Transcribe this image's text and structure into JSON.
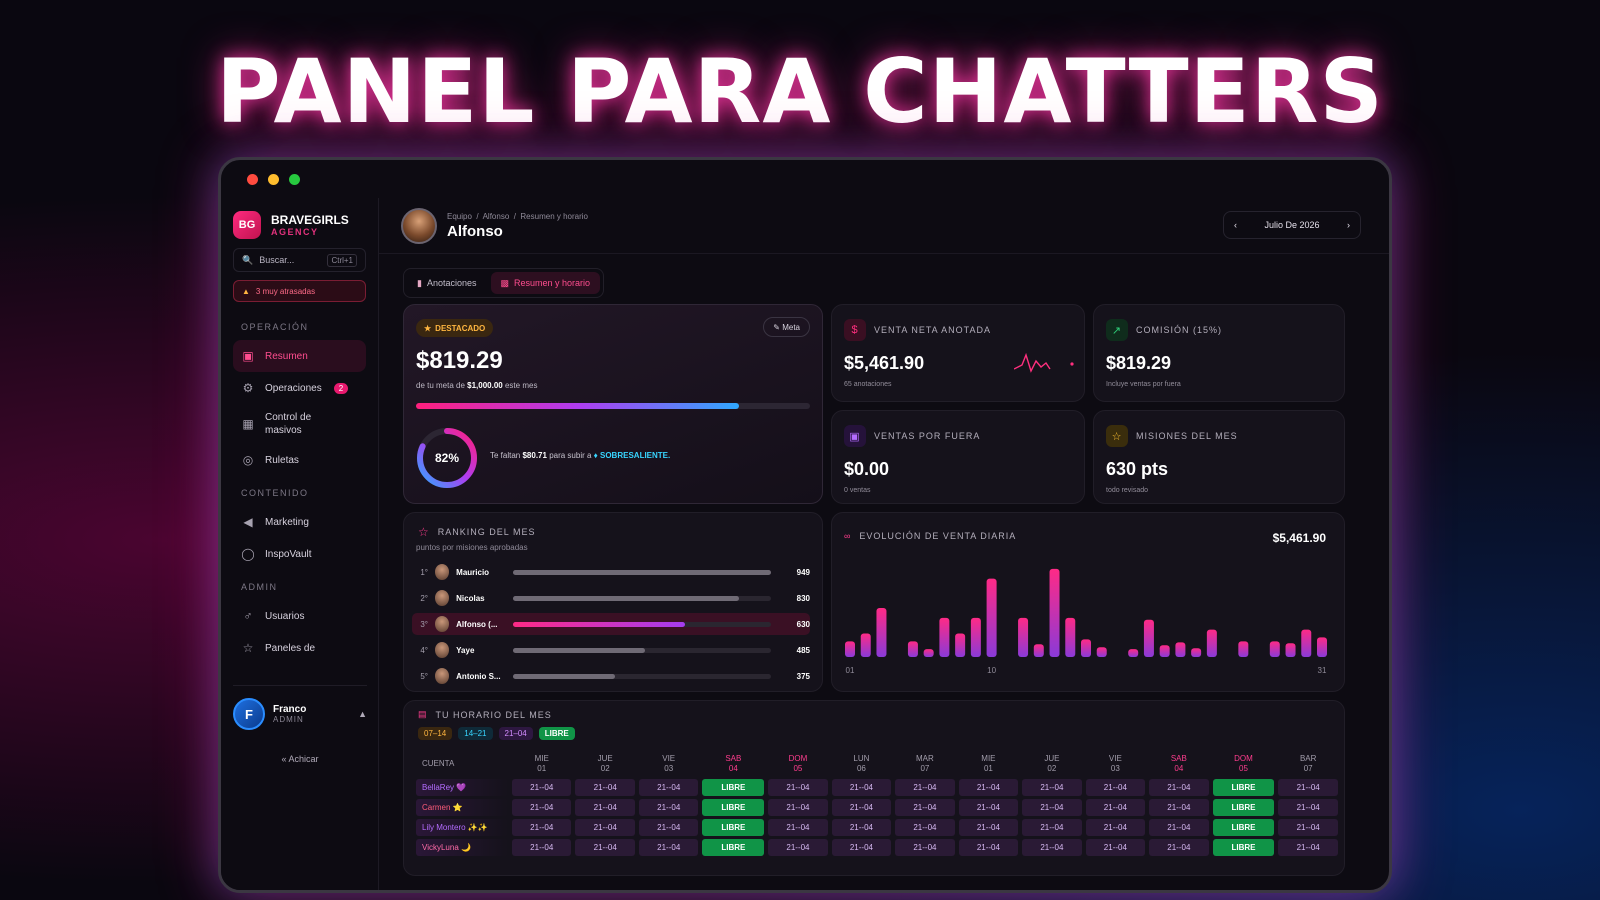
{
  "hero_title": "PANEL PARA CHATTERS",
  "sidebar": {
    "logo": "BG",
    "brand": "BRAVEGIRLS",
    "brand_sub": "AGENCY",
    "search_placeholder": "Buscar...",
    "search_shortcut": "Ctrl+1",
    "late_alert": "3 muy atrasadas",
    "sections": {
      "operacion": "OPERACIÓN",
      "contenido": "CONTENIDO",
      "admin": "ADMIN"
    },
    "items": [
      {
        "label": "Resumen",
        "icon": "gift-icon"
      },
      {
        "label": "Operaciones",
        "icon": "gear-icon",
        "badge": "2"
      },
      {
        "label": "Control de masivos",
        "icon": "film-icon"
      },
      {
        "label": "Ruletas",
        "icon": "globe-icon"
      },
      {
        "label": "Marketing",
        "icon": "megaphone-icon"
      },
      {
        "label": "InspoVault",
        "icon": "lightbulb-icon"
      },
      {
        "label": "Usuarios",
        "icon": "user-icon"
      },
      {
        "label": "Paneles de",
        "icon": "star-icon"
      }
    ],
    "user": {
      "initial": "F",
      "name": "Franco",
      "role": "ADMIN"
    },
    "collapse": "« Achicar"
  },
  "header": {
    "breadcrumb": [
      "Equipo",
      "Alfonso",
      "Resumen y horario"
    ],
    "name": "Alfonso",
    "month": "Julio De 2026"
  },
  "tabs": [
    "Anotaciones",
    "Resumen y horario"
  ],
  "featured": {
    "badge": "DESTACADO",
    "meta_button": "Meta",
    "value": "$819.29",
    "goal_prefix": "de tu meta de",
    "goal_amount": "$1,000.00",
    "goal_suffix": "este mes",
    "progress": 0.82,
    "percent": "82%",
    "remaining_prefix": "Te faltan",
    "remaining_amount": "$80.71",
    "remaining_mid": "para subir a",
    "next_level": "SOBRESALIENTE."
  },
  "kpis": [
    {
      "title": "VENTA NETA ANOTADA",
      "value": "$5,461.90",
      "sub": "65 anotaciones",
      "color": "#ff2f7e"
    },
    {
      "title": "COMISIÓN (15%)",
      "value": "$819.29",
      "sub": "Incluye ventas por fuera",
      "color": "#2fd07a"
    },
    {
      "title": "VENTAS POR FUERA",
      "value": "$0.00",
      "sub": "0 ventas",
      "color": "#b36cff"
    },
    {
      "title": "MISIONES DEL MES",
      "value": "630 pts",
      "sub": "todo revisado",
      "color": "#ffc233"
    }
  ],
  "ranking": {
    "title": "RANKING DEL MES",
    "subtitle": "puntos por misiones aprobadas",
    "max": 949,
    "rows": [
      {
        "pos": "1°",
        "name": "Mauricio",
        "pts": 949
      },
      {
        "pos": "2°",
        "name": "Nicolas",
        "pts": 830
      },
      {
        "pos": "3°",
        "name": "Alfonso (...",
        "pts": 630,
        "me": true
      },
      {
        "pos": "4°",
        "name": "Yaye",
        "pts": 485
      },
      {
        "pos": "5°",
        "name": "Antonio S...",
        "pts": 375
      }
    ]
  },
  "evolution": {
    "title": "EVOLUCIÓN DE VENTA DIARIA",
    "total": "$5,461.90"
  },
  "chart_data": {
    "type": "bar",
    "x": [
      1,
      2,
      3,
      4,
      5,
      6,
      7,
      8,
      9,
      10,
      11,
      12,
      13,
      14,
      15,
      16,
      17,
      18,
      19,
      20,
      21,
      22,
      23,
      24,
      25,
      26,
      27,
      28,
      29,
      30,
      31
    ],
    "values": [
      80,
      120,
      250,
      0,
      80,
      40,
      200,
      120,
      200,
      400,
      0,
      200,
      65,
      450,
      200,
      90,
      50,
      0,
      40,
      190,
      60,
      75,
      45,
      140,
      0,
      80,
      0,
      80,
      70,
      140,
      100
    ],
    "x_ticks": [
      "01",
      "10",
      "31"
    ],
    "ylim": [
      0,
      480
    ]
  },
  "schedule": {
    "title": "TU HORARIO DEL MES",
    "legend": [
      {
        "label": "07–14",
        "color": "#ffb640",
        "bg": "#3a2710"
      },
      {
        "label": "14–21",
        "color": "#38d5ff",
        "bg": "#0f2a38"
      },
      {
        "label": "21–04",
        "color": "#d38cff",
        "bg": "#2d1740"
      },
      {
        "label": "LIBRE",
        "color": "#ffffff",
        "bg": "#109447"
      }
    ],
    "account_header": "CUENTA",
    "days": [
      {
        "d": "MIE",
        "n": "01"
      },
      {
        "d": "JUE",
        "n": "02"
      },
      {
        "d": "VIE",
        "n": "03"
      },
      {
        "d": "SAB",
        "n": "04",
        "weekend": true
      },
      {
        "d": "DOM",
        "n": "05",
        "weekend": true
      },
      {
        "d": "LUN",
        "n": "06"
      },
      {
        "d": "MAR",
        "n": "07"
      },
      {
        "d": "MIE",
        "n": "01"
      },
      {
        "d": "JUE",
        "n": "02"
      },
      {
        "d": "VIE",
        "n": "03"
      },
      {
        "d": "SAB",
        "n": "04",
        "weekend": true
      },
      {
        "d": "DOM",
        "n": "05",
        "weekend": true
      },
      {
        "d": "BAR",
        "n": "07"
      }
    ],
    "accounts": [
      {
        "name": "BellaRey 💜",
        "color": "#b46cff"
      },
      {
        "name": "Carmen ⭐",
        "color": "#ff5c7a"
      },
      {
        "name": "Lily Montero ✨✨",
        "color": "#b46cff"
      },
      {
        "name": "VickyLuna 🌙",
        "color": "#ff6ba8"
      }
    ],
    "row_cells": [
      "21--04",
      "21--04",
      "21--04",
      "LIBRE",
      "21--04",
      "21--04",
      "21--04",
      "21--04",
      "21--04",
      "21--04",
      "21--04",
      "LIBRE",
      "21--04"
    ]
  }
}
